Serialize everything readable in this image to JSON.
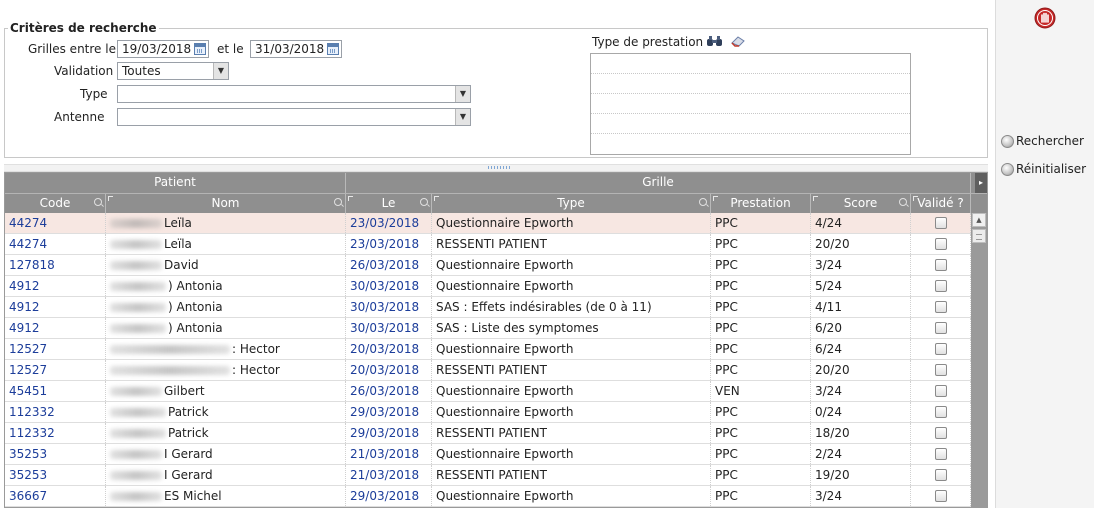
{
  "criteria": {
    "title": "Critères de recherche",
    "grilles_label": "Grilles entre le",
    "date_from": "19/03/2018",
    "et_le_label": "et le",
    "date_to": "31/03/2018",
    "validation_label": "Validation",
    "validation_value": "Toutes",
    "type_label": "Type",
    "type_value": "",
    "antenne_label": "Antenne",
    "antenne_value": "",
    "type_prestation_label": "Type de prestation"
  },
  "actions": {
    "search_label": "Rechercher",
    "reset_label": "Réinitialiser"
  },
  "grid": {
    "group_headers": {
      "patient": "Patient",
      "grille": "Grille"
    },
    "columns": {
      "code": "Code",
      "nom": "Nom",
      "le": "Le",
      "type": "Type",
      "prestation": "Prestation",
      "score": "Score",
      "valide": "Validé ?"
    },
    "rows": [
      {
        "code": "44274",
        "nom": "Leïla",
        "le": "23/03/2018",
        "type": "Questionnaire Epworth",
        "prestation": "PPC",
        "score": "4/24"
      },
      {
        "code": "44274",
        "nom": "Leïla",
        "le": "23/03/2018",
        "type": "RESSENTI PATIENT",
        "prestation": "PPC",
        "score": "20/20"
      },
      {
        "code": "127818",
        "nom": "David",
        "le": "26/03/2018",
        "type": "Questionnaire Epworth",
        "prestation": "PPC",
        "score": "3/24"
      },
      {
        "code": "4912",
        "nom": ") Antonia",
        "le": "30/03/2018",
        "type": "Questionnaire Epworth",
        "prestation": "PPC",
        "score": "5/24"
      },
      {
        "code": "4912",
        "nom": ") Antonia",
        "le": "30/03/2018",
        "type": "SAS : Effets indésirables (de 0 à 11)",
        "prestation": "PPC",
        "score": "4/11"
      },
      {
        "code": "4912",
        "nom": ") Antonia",
        "le": "30/03/2018",
        "type": "SAS : Liste des symptomes",
        "prestation": "PPC",
        "score": "6/20"
      },
      {
        "code": "12527",
        "nom": ": Hector",
        "le": "20/03/2018",
        "type": "Questionnaire Epworth",
        "prestation": "PPC",
        "score": "6/24"
      },
      {
        "code": "12527",
        "nom": ": Hector",
        "le": "20/03/2018",
        "type": "RESSENTI PATIENT",
        "prestation": "PPC",
        "score": "20/20"
      },
      {
        "code": "45451",
        "nom": "Gilbert",
        "le": "26/03/2018",
        "type": "Questionnaire Epworth",
        "prestation": "VEN",
        "score": "3/24"
      },
      {
        "code": "112332",
        "nom": "Patrick",
        "le": "29/03/2018",
        "type": "Questionnaire Epworth",
        "prestation": "PPC",
        "score": "0/24"
      },
      {
        "code": "112332",
        "nom": "Patrick",
        "le": "29/03/2018",
        "type": "RESSENTI PATIENT",
        "prestation": "PPC",
        "score": "18/20"
      },
      {
        "code": "35253",
        "nom": "I Gerard",
        "le": "21/03/2018",
        "type": "Questionnaire Epworth",
        "prestation": "PPC",
        "score": "2/24"
      },
      {
        "code": "35253",
        "nom": "I Gerard",
        "le": "21/03/2018",
        "type": "RESSENTI PATIENT",
        "prestation": "PPC",
        "score": "19/20"
      },
      {
        "code": "36667",
        "nom": "ES Michel",
        "le": "29/03/2018",
        "type": "Questionnaire Epworth",
        "prestation": "PPC",
        "score": "3/24"
      }
    ]
  },
  "colors": {
    "header_bg": "#8f8f8f",
    "link_blue": "#1c3d9a",
    "selected_row": "#f7e7e2",
    "stop_red": "#c62828"
  }
}
